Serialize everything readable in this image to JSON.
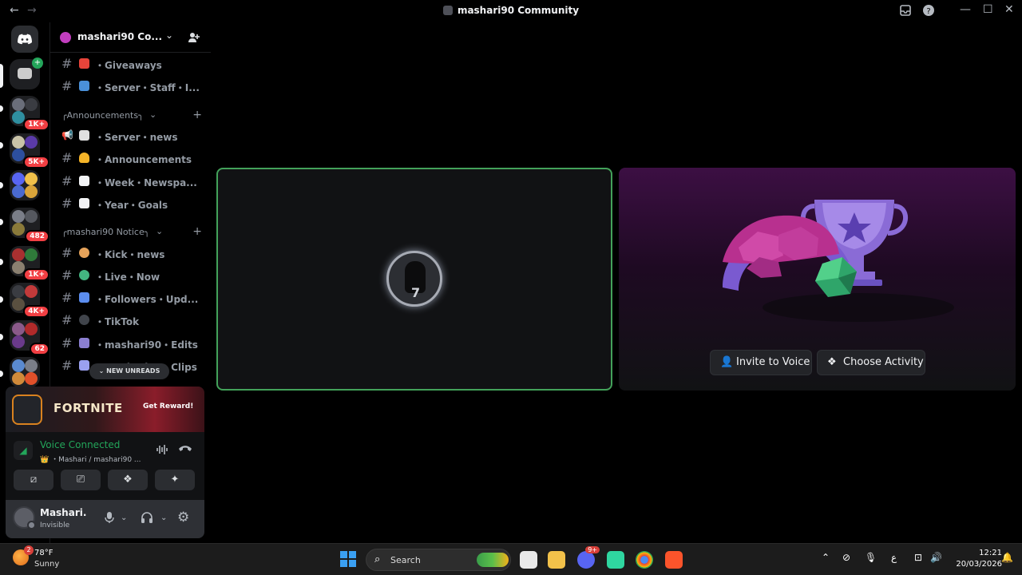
{
  "titlebar": {
    "back": "←",
    "forward": "→",
    "title": "mashari90 Community",
    "minimize": "—",
    "maximize": "☐",
    "close": "✕"
  },
  "rail": {
    "badges": [
      "1K+",
      "5K+",
      "482",
      "1K+",
      "4K+",
      "62"
    ]
  },
  "server": {
    "name": "mashari90 Co...",
    "chevron": "⌄",
    "invite_icon": "person-add-icon"
  },
  "channels_top": [
    {
      "label": "・Giveaways",
      "icon_color": "#e8443a"
    },
    {
      "label": "・Server・Staff・I...",
      "icon_color": "#4a90d9"
    }
  ],
  "category1": {
    "label": "╭Announcements╮",
    "chev": "⌄",
    "plus": "+"
  },
  "channels_ann": [
    {
      "label": "・Server・news",
      "icon_color": "#e0e0e0"
    },
    {
      "label": "・Announcements",
      "icon_color": "#f5b428"
    },
    {
      "label": "・Week・Newspa...",
      "icon_color": "#f2f3f5"
    },
    {
      "label": "・Year・Goals",
      "icon_color": "#f2f3f5"
    }
  ],
  "category2": {
    "label": "╭mashari90 Notice╮",
    "chev": "⌄",
    "plus": "+"
  },
  "channels_notice": [
    {
      "label": "・Kick・news",
      "icon_color": "#e6a35a"
    },
    {
      "label": "・Live・Now",
      "icon_color": "#43b581"
    },
    {
      "label": "・Followers・Upd...",
      "icon_color": "#5b8def"
    },
    {
      "label": "・TikTok",
      "icon_color": "#40444b"
    },
    {
      "label": "・mashari90・Edits",
      "icon_color": "#8b7fd1"
    },
    {
      "label": "・mashari90・Clips",
      "icon_color": "#9aa0f0"
    }
  ],
  "new_unreads": "⌄  NEW UNREADS",
  "promo": {
    "brand": "FORTNITE",
    "cta": "Get Reward!"
  },
  "voice": {
    "status": "Voice Connected",
    "location": "👑 ・Mashari / mashari90 ...",
    "buttons": [
      "⧄",
      "⎚",
      "❖",
      "✦"
    ]
  },
  "user": {
    "name": "Mashari.",
    "status": "Invisible"
  },
  "stage": {
    "tile_number": "7",
    "invite_label": "Invite to Voice",
    "activity_label": "Choose Activity"
  },
  "taskbar": {
    "weather_badge": "2",
    "temperature": "78°F",
    "condition": "Sunny",
    "search_label": "Search",
    "discord_badge": "9+",
    "language": "ع",
    "time": "12:21",
    "date": "20/03/2026"
  }
}
